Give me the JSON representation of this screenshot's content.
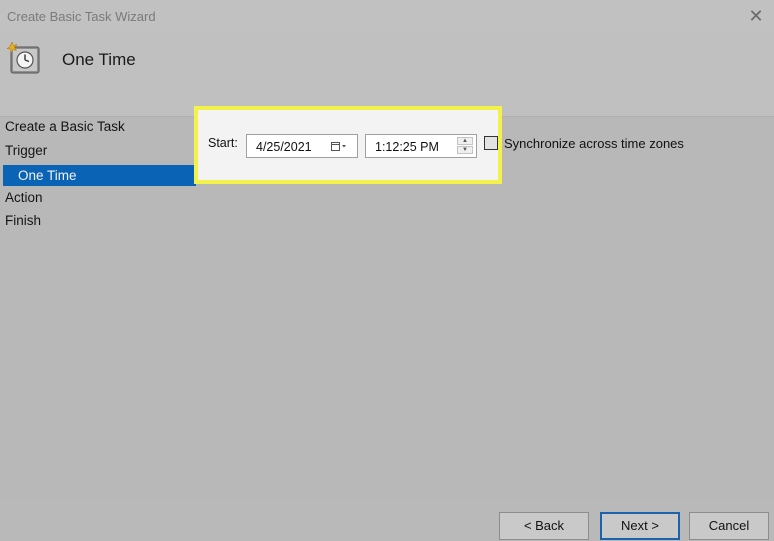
{
  "window": {
    "title": "Create Basic Task Wizard",
    "close_glyph": "✕"
  },
  "header": {
    "title": "One Time",
    "icon": "scheduled-task-clock-icon"
  },
  "nav": {
    "items": [
      {
        "label": "Create a Basic Task"
      },
      {
        "label": "Trigger"
      },
      {
        "label": "One Time"
      },
      {
        "label": "Action"
      },
      {
        "label": "Finish"
      }
    ],
    "selected_index": 2
  },
  "form": {
    "start_label": "Start:",
    "date_value": "4/25/2021",
    "time_value": "1:12:25 PM",
    "sync_label": "Synchronize across time zones",
    "sync_checked": false
  },
  "buttons": {
    "back": "< Back",
    "next": "Next >",
    "cancel": "Cancel"
  },
  "colors": {
    "highlight_border": "#f3f24a",
    "selection": "#0b63b5"
  }
}
